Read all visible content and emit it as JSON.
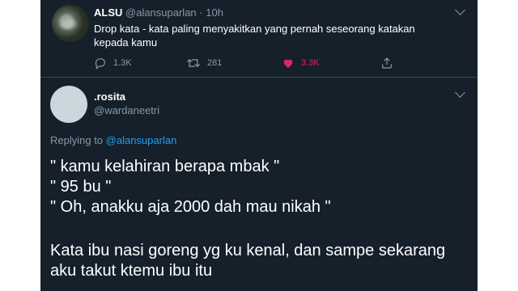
{
  "tweet": {
    "author_name": "ALSU",
    "author_handle": "@alansuparlan",
    "separator": "·",
    "time": "10h",
    "text": "Drop kata - kata paling menyakitkan yang pernah seseorang katakan kepada kamu",
    "reply_count": "1.3K",
    "retweet_count": "281",
    "like_count": "3.3K",
    "like_color": "#e0245e",
    "icons": [
      "reply-icon",
      "retweet-icon",
      "heart-icon",
      "share-icon",
      "chevron-down-icon"
    ]
  },
  "reply": {
    "author_name": ".rosita",
    "author_handle": "@wardaneetri",
    "replying_to_label": "Replying to",
    "replying_to_handle": "@alansuparlan",
    "lines": [
      "\" kamu kelahiran berapa mbak \"",
      "\" 95 bu \"",
      "\" Oh, anakku aja 2000 dah mau nikah \""
    ],
    "paragraph": [
      "Kata ibu nasi goreng yg ku kenal, dan sampe sekarang",
      "aku takut ktemu ibu itu"
    ]
  },
  "theme": {
    "background": "#15202b",
    "muted_text": "#8899a6",
    "link": "#1da1f2",
    "divider": "#38444d"
  }
}
